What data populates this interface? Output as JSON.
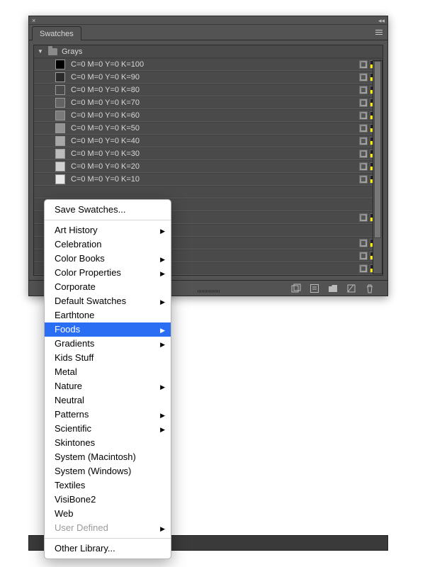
{
  "panel": {
    "tab_label": "Swatches",
    "folder_name": "Grays"
  },
  "swatches": [
    {
      "label": "C=0 M=0 Y=0 K=100",
      "color": "#000000",
      "icons": true
    },
    {
      "label": "C=0 M=0 Y=0 K=90",
      "color": "#2b2b2b",
      "icons": true
    },
    {
      "label": "C=0 M=0 Y=0 K=80",
      "color": "#4a4a4a",
      "icons": true
    },
    {
      "label": "C=0 M=0 Y=0 K=70",
      "color": "#636363",
      "icons": true
    },
    {
      "label": "C=0 M=0 Y=0 K=60",
      "color": "#7a7a7a",
      "icons": true
    },
    {
      "label": "C=0 M=0 Y=0 K=50",
      "color": "#939393",
      "icons": true
    },
    {
      "label": "C=0 M=0 Y=0 K=40",
      "color": "#a8a8a8",
      "icons": true
    },
    {
      "label": "C=0 M=0 Y=0 K=30",
      "color": "#bcbcbc",
      "icons": true
    },
    {
      "label": "C=0 M=0 Y=0 K=20",
      "color": "#d1d1d1",
      "icons": true
    },
    {
      "label": "C=0 M=0 Y=0 K=10",
      "color": "#e8e8e8",
      "icons": true
    }
  ],
  "empty_rows": 7,
  "empty_icons_at": [
    2,
    4,
    5,
    6
  ],
  "menu": {
    "save_label": "Save Swatches...",
    "items": [
      {
        "label": "Art History",
        "sub": true
      },
      {
        "label": "Celebration",
        "sub": false
      },
      {
        "label": "Color Books",
        "sub": true
      },
      {
        "label": "Color Properties",
        "sub": true
      },
      {
        "label": "Corporate",
        "sub": false
      },
      {
        "label": "Default Swatches",
        "sub": true
      },
      {
        "label": "Earthtone",
        "sub": false
      },
      {
        "label": "Foods",
        "sub": true,
        "highlight": true
      },
      {
        "label": "Gradients",
        "sub": true
      },
      {
        "label": "Kids Stuff",
        "sub": false
      },
      {
        "label": "Metal",
        "sub": false
      },
      {
        "label": "Nature",
        "sub": true
      },
      {
        "label": "Neutral",
        "sub": false
      },
      {
        "label": "Patterns",
        "sub": true
      },
      {
        "label": "Scientific",
        "sub": true
      },
      {
        "label": "Skintones",
        "sub": false
      },
      {
        "label": "System (Macintosh)",
        "sub": false
      },
      {
        "label": "System (Windows)",
        "sub": false
      },
      {
        "label": "Textiles",
        "sub": false
      },
      {
        "label": "VisiBone2",
        "sub": false
      },
      {
        "label": "Web",
        "sub": false
      },
      {
        "label": "User Defined",
        "sub": true,
        "disabled": true
      }
    ],
    "other_label": "Other Library..."
  }
}
